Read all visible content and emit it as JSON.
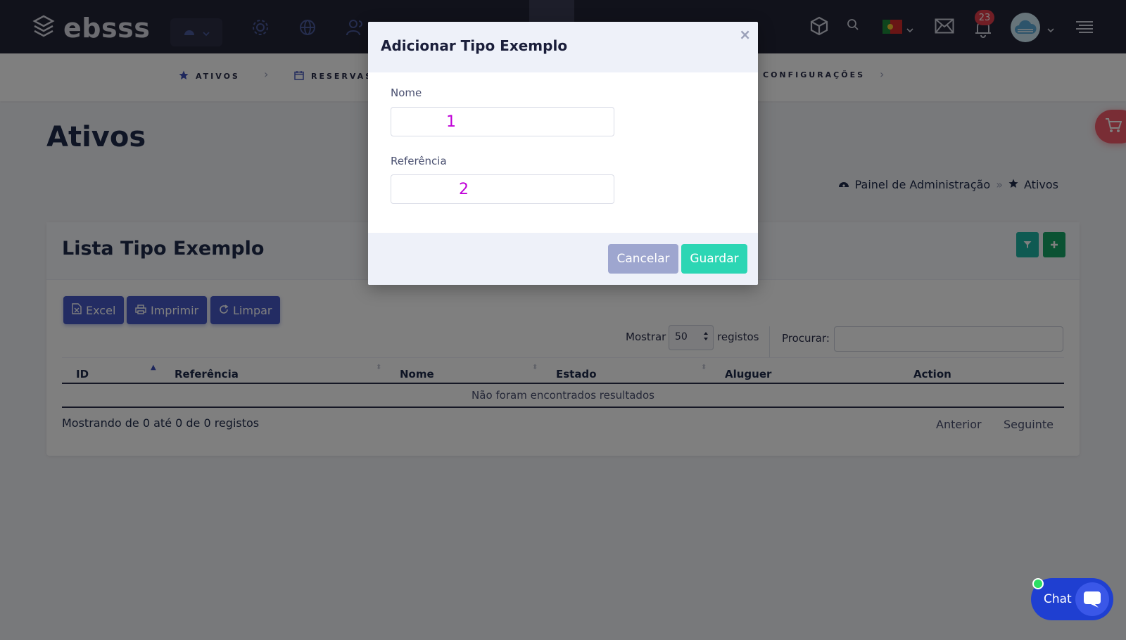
{
  "app": {
    "brand": "ebsss"
  },
  "topbar": {
    "notification_count": "23"
  },
  "subnav": {
    "items": [
      {
        "label": "ATIVOS"
      },
      {
        "label": "RESERVAS"
      },
      {
        "label": "CONFIGURAÇÕES"
      }
    ]
  },
  "page": {
    "title": "Ativos",
    "breadcrumb": {
      "home": "Painel de Administração",
      "separator": "»",
      "current": "Ativos"
    }
  },
  "card": {
    "title": "Lista Tipo Exemplo",
    "toolbar": {
      "excel": "Excel",
      "print": "Imprimir",
      "clear": "Limpar"
    },
    "show_label": "Mostrar",
    "show_value": "50",
    "records_label": "registos",
    "search_label": "Procurar:",
    "table": {
      "columns": [
        "ID",
        "Referência",
        "Nome",
        "Estado",
        "Aluguer",
        "Action"
      ],
      "empty": "Não foram encontrados resultados"
    },
    "info": "Mostrando de 0 até 0 de 0 registos",
    "pager": {
      "prev": "Anterior",
      "next": "Seguinte"
    }
  },
  "modal": {
    "title": "Adicionar Tipo Exemplo",
    "close": "×",
    "fields": [
      {
        "label": "Nome",
        "value": "1"
      },
      {
        "label": "Referência",
        "value": "2"
      }
    ],
    "cancel": "Cancelar",
    "save": "Guardar"
  },
  "chat": {
    "label": "Chat"
  },
  "colors": {
    "topbar": "#232437",
    "accent": "#4759c6",
    "save": "#2cd6b4",
    "cancel": "#9ea6cf",
    "badge": "#e23d4b"
  }
}
